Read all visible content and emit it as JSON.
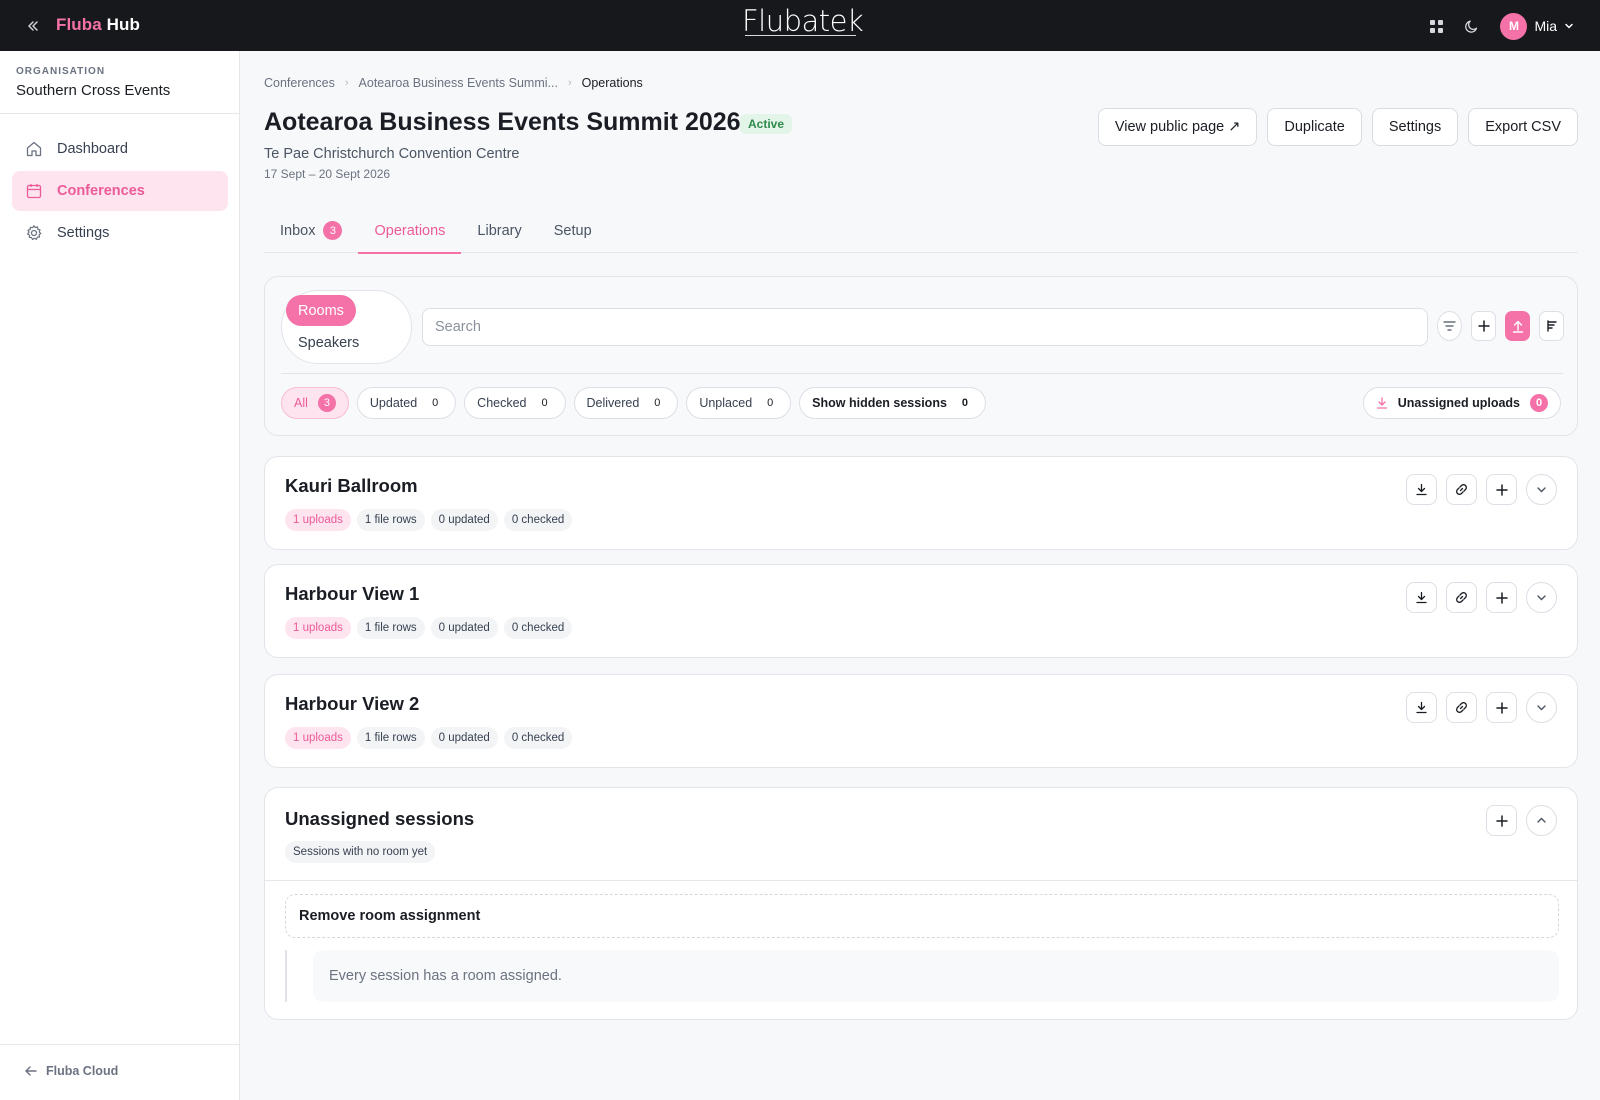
{
  "app": {
    "brand_part1": "Fluba",
    "brand_part2": "Hub",
    "logo_text": "Flubatek"
  },
  "user": {
    "initial": "M",
    "name": "Mia"
  },
  "sidebar": {
    "org_label": "ORGANISATION",
    "org_name": "Southern Cross Events",
    "items": [
      {
        "label": "Dashboard",
        "icon": "home-icon"
      },
      {
        "label": "Conferences",
        "icon": "calendar-icon",
        "active": true
      },
      {
        "label": "Settings",
        "icon": "gear-icon"
      }
    ],
    "footer_link": "Fluba Cloud"
  },
  "breadcrumb": [
    "Conferences",
    "Aotearoa Business Events Summi...",
    "Operations"
  ],
  "event": {
    "title": "Aotearoa Business Events Summit 2026",
    "status": "Active",
    "venue": "Te Pae Christchurch Convention Centre",
    "dates": "17 Sept – 20 Sept 2026"
  },
  "header_actions": [
    "View public page ↗",
    "Duplicate",
    "Settings",
    "Export CSV"
  ],
  "tabs": [
    {
      "label": "Inbox",
      "count": "3"
    },
    {
      "label": "Operations",
      "active": true
    },
    {
      "label": "Library"
    },
    {
      "label": "Setup"
    }
  ],
  "view_toggle": {
    "active": "Rooms",
    "other": "Speakers"
  },
  "search": {
    "placeholder": "Search",
    "value": ""
  },
  "filters": [
    {
      "label": "All",
      "count": "3",
      "active": true
    },
    {
      "label": "Updated",
      "count": "0"
    },
    {
      "label": "Checked",
      "count": "0"
    },
    {
      "label": "Delivered",
      "count": "0"
    },
    {
      "label": "Unplaced",
      "count": "0"
    },
    {
      "label": "Show hidden sessions",
      "count": "0"
    }
  ],
  "unassigned_uploads": {
    "label": "Unassigned uploads",
    "count": "0"
  },
  "rooms": [
    {
      "name": "Kauri Ballroom",
      "stats": [
        "1 uploads",
        "1 file rows",
        "0 updated",
        "0 checked"
      ]
    },
    {
      "name": "Harbour View 1",
      "stats": [
        "1 uploads",
        "1 file rows",
        "0 updated",
        "0 checked"
      ]
    },
    {
      "name": "Harbour View 2",
      "stats": [
        "1 uploads",
        "1 file rows",
        "0 updated",
        "0 checked"
      ]
    }
  ],
  "unassigned_sessions": {
    "title": "Unassigned sessions",
    "subtitle": "Sessions with no room yet",
    "remove_label": "Remove room assignment",
    "empty_text": "Every session has a room assigned."
  },
  "colors": {
    "accent": "#f472a8",
    "topbar": "#17181c",
    "success": "#2f8a4b"
  }
}
